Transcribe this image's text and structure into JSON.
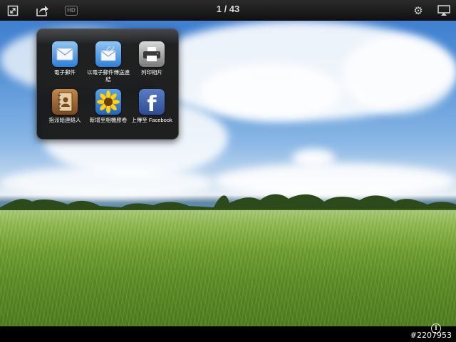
{
  "toolbar": {
    "counter": "1 / 43",
    "hd_label": "HD",
    "icons": [
      "fullscreen-icon",
      "share-icon",
      "hd-icon",
      "gear-icon",
      "airplay-icon"
    ]
  },
  "share_menu": {
    "items": [
      {
        "label": "電子郵件",
        "icon": "mail-icon"
      },
      {
        "label": "以電子郵件傳送連結",
        "icon": "mail-link-icon"
      },
      {
        "label": "列印相片",
        "icon": "printer-icon"
      },
      {
        "label": "指派給連絡人",
        "icon": "contact-book-icon"
      },
      {
        "label": "新增至相機膠卷",
        "icon": "sunflower-icon"
      },
      {
        "label": "上傳至 Facebook",
        "icon": "facebook-icon"
      }
    ]
  },
  "footer": {
    "info_icon": "info-icon",
    "watermark": "#2207953"
  },
  "colors": {
    "toolbar": "#1e1e1e",
    "popover": "#1a1a1a",
    "facebook": "#3b5998"
  }
}
